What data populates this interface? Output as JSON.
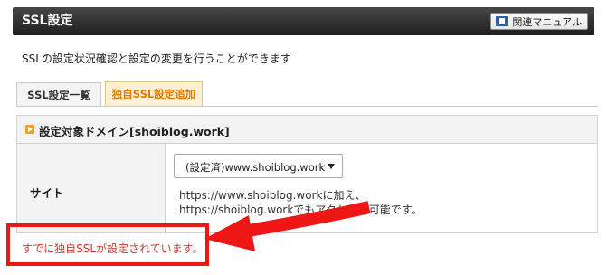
{
  "header": {
    "title": "SSL設定",
    "manual_button": "関連マニュアル"
  },
  "description": "SSLの設定状況確認と設定の変更を行うことができます",
  "tabs": [
    {
      "label": "SSL設定一覧",
      "active": false
    },
    {
      "label": "独自SSL設定追加",
      "active": true
    }
  ],
  "panel": {
    "title": "設定対象ドメイン[shoiblog.work]",
    "site_label": "サイト",
    "site_select": {
      "selected": "(設定済)www.shoiblog.work"
    },
    "note_line1": "https://www.shoiblog.workに加え、",
    "note_line2": "https://shoiblog.workでもアクセスが可能です。"
  },
  "error_message": "すでに独自SSLが設定されています。",
  "colors": {
    "header_bg": "#2b2b2b",
    "active_tab_text": "#e07a00",
    "error_text": "#d9342b",
    "annotation": "#ef1616"
  },
  "icons": [
    "manual-book-icon",
    "section-bullet-icon",
    "select-arrow-icon",
    "annotation-arrow"
  ]
}
